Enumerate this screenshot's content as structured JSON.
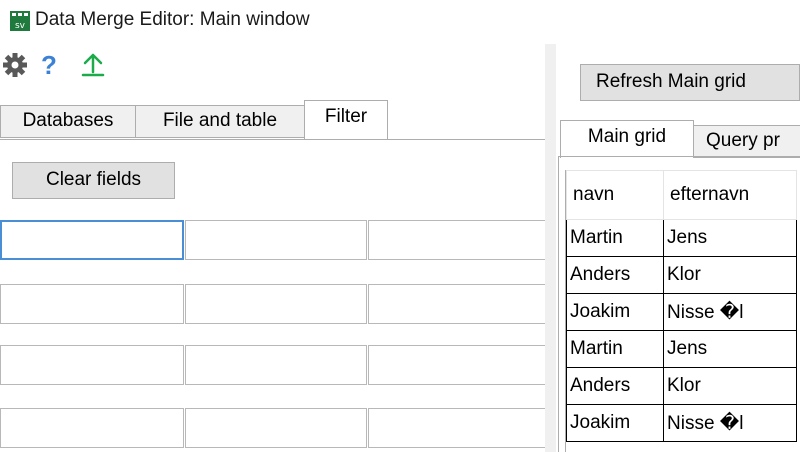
{
  "window": {
    "title": "Data Merge Editor: Main window",
    "app_icon": "sv-grid-icon"
  },
  "toolbar": {
    "icons": [
      "gear-icon",
      "help-icon",
      "upload-icon"
    ],
    "help_glyph": "?"
  },
  "left_tabs": [
    {
      "label": "Databases",
      "active": false
    },
    {
      "label": "File and table",
      "active": false
    },
    {
      "label": "Filter",
      "active": true
    }
  ],
  "filter": {
    "clear_label": "Clear fields"
  },
  "right": {
    "refresh_label": "Refresh Main grid",
    "tabs": [
      {
        "label": "Main grid",
        "active": true
      },
      {
        "label": "Query pr",
        "active": false
      }
    ]
  },
  "grid": {
    "columns": [
      "navn",
      "efternavn"
    ],
    "rows": [
      [
        "Martin",
        "Jens"
      ],
      [
        "Anders",
        "Klor"
      ],
      [
        "Joakim",
        "Nisse �l"
      ],
      [
        "Martin",
        "Jens"
      ],
      [
        "Anders",
        "Klor"
      ],
      [
        "Joakim",
        "Nisse �l"
      ]
    ]
  },
  "colors": {
    "accent": "#4a8fd6",
    "upload_green": "#1bab4b",
    "help_blue": "#3b82d6",
    "gear_gray": "#595959"
  }
}
